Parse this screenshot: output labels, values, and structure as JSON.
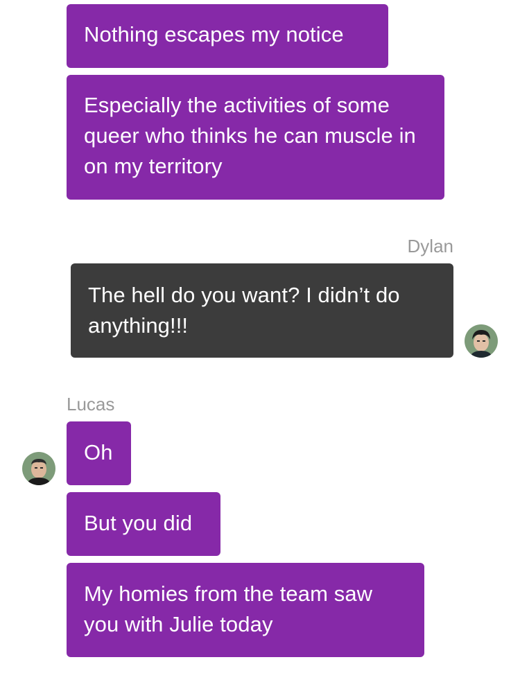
{
  "messages": [
    {
      "sender": "Lucas",
      "text": "Nothing escapes my notice"
    },
    {
      "sender": "Lucas",
      "text": "Especially the activities of some queer who thinks he can muscle in on my territory"
    },
    {
      "sender": "Dylan",
      "text": "The hell do you want? I didn’t do anything!!!"
    },
    {
      "sender": "Lucas",
      "text": "Oh"
    },
    {
      "sender": "Lucas",
      "text": "But you did"
    },
    {
      "sender": "Lucas",
      "text": "My homies from the team saw you with Julie today"
    }
  ],
  "labels": {
    "dylan": "Dylan",
    "lucas": "Lucas"
  },
  "avatars": {
    "dylan": "dylan-avatar-icon",
    "lucas": "lucas-avatar-icon"
  },
  "colors": {
    "incoming_bubble": "#8629a8",
    "outgoing_bubble": "#3c3c3c",
    "sender_label": "#999999",
    "background": "#ffffff"
  }
}
